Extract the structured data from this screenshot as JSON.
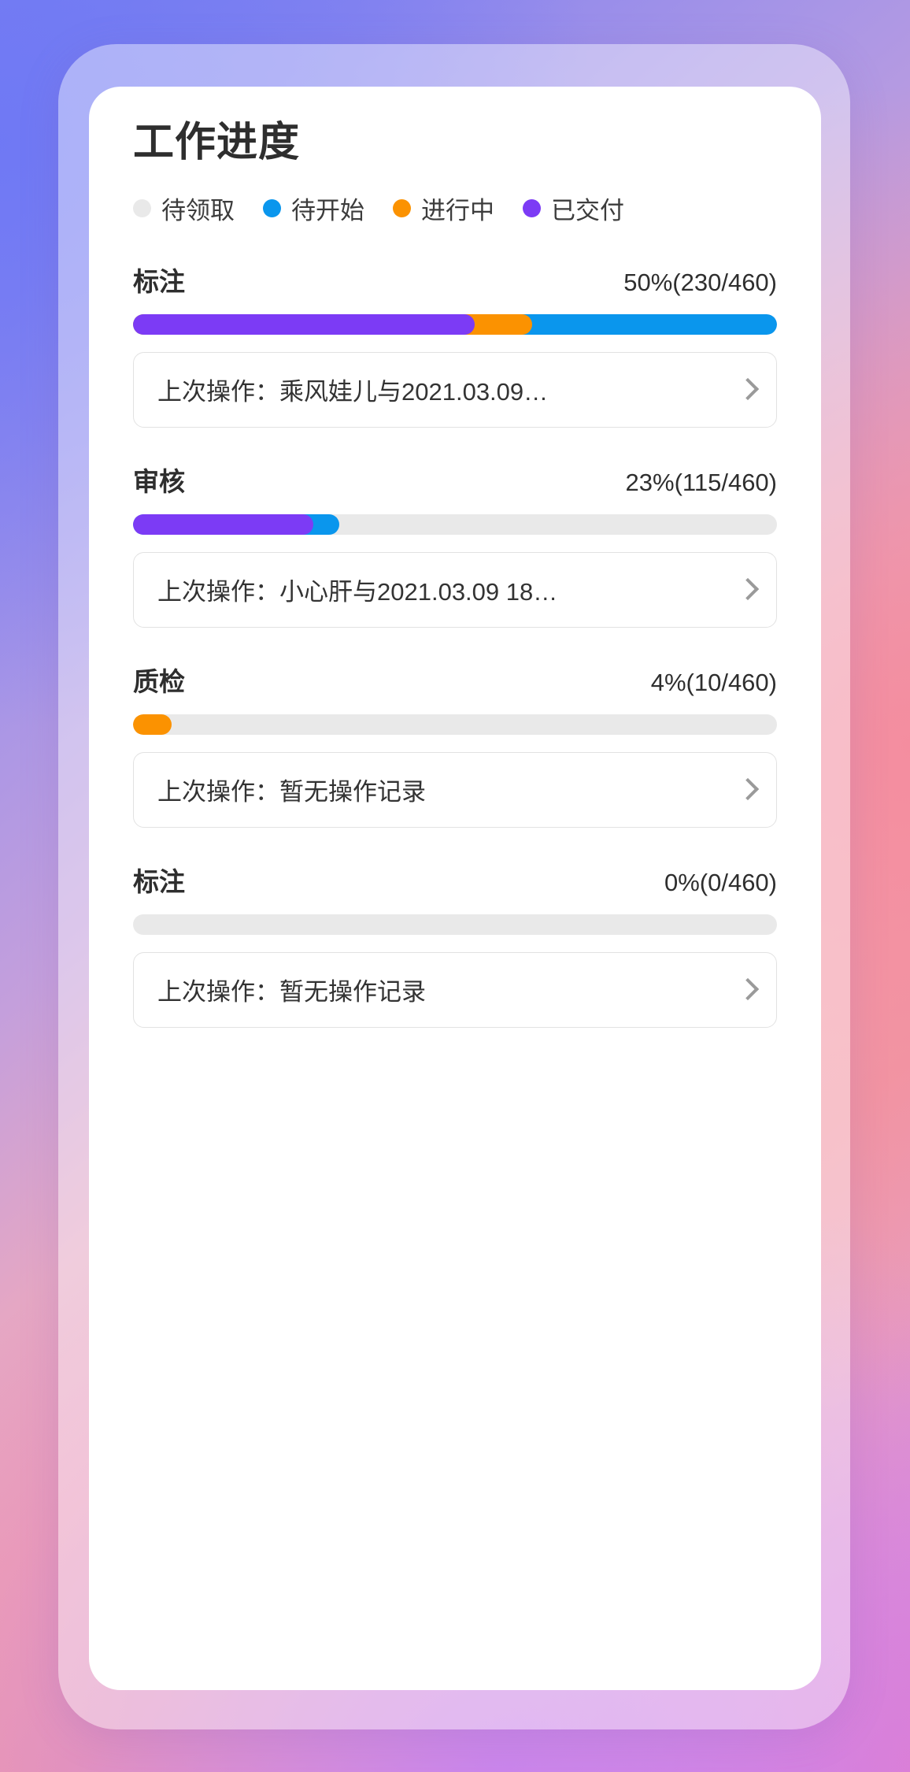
{
  "header": {
    "title": "工作进度"
  },
  "legend": {
    "items": [
      {
        "label": "待领取",
        "color": "#e9e9e9",
        "icon": "status-dot-icon"
      },
      {
        "label": "待开始",
        "color": "#0a96ed",
        "icon": "status-dot-icon"
      },
      {
        "label": "进行中",
        "color": "#fb9201",
        "icon": "status-dot-icon"
      },
      {
        "label": "已交付",
        "color": "#7c3bf5",
        "icon": "status-dot-icon"
      }
    ]
  },
  "progress_groups": [
    {
      "name": "标注",
      "stat": "50%(230/460)",
      "percent": 50,
      "done": 230,
      "total": 460,
      "segments": [
        {
          "status": "已交付",
          "color": "#7c3bf5",
          "width_pct": 53
        },
        {
          "status": "进行中",
          "color": "#fb9201",
          "width_pct": 62
        },
        {
          "status": "待开始",
          "color": "#0a96ed",
          "width_pct": 100
        }
      ],
      "last_operation": "上次操作：乘风娃儿与2021.03.09…"
    },
    {
      "name": "审核",
      "stat": "23%(115/460)",
      "percent": 23,
      "done": 115,
      "total": 460,
      "segments": [
        {
          "status": "已交付",
          "color": "#7c3bf5",
          "width_pct": 28
        },
        {
          "status": "待开始",
          "color": "#0a96ed",
          "width_pct": 32
        }
      ],
      "last_operation": "上次操作：小心肝与2021.03.09 18…"
    },
    {
      "name": "质检",
      "stat": "4%(10/460)",
      "percent": 4,
      "done": 10,
      "total": 460,
      "segments": [
        {
          "status": "进行中",
          "color": "#fb9201",
          "width_pct": 6
        }
      ],
      "last_operation": "上次操作：暂无操作记录"
    },
    {
      "name": "标注",
      "stat": "0%(0/460)",
      "percent": 0,
      "done": 0,
      "total": 460,
      "segments": [],
      "last_operation": "上次操作：暂无操作记录"
    }
  ],
  "colors": {
    "track": "#e9e9e9",
    "pending_claim": "#e9e9e9",
    "pending_start": "#0a96ed",
    "in_progress": "#fb9201",
    "delivered": "#7c3bf5",
    "text_primary": "#2e2e2e",
    "card_background": "#ffffff"
  },
  "chevron": {
    "icon": "chevron-right-icon"
  }
}
